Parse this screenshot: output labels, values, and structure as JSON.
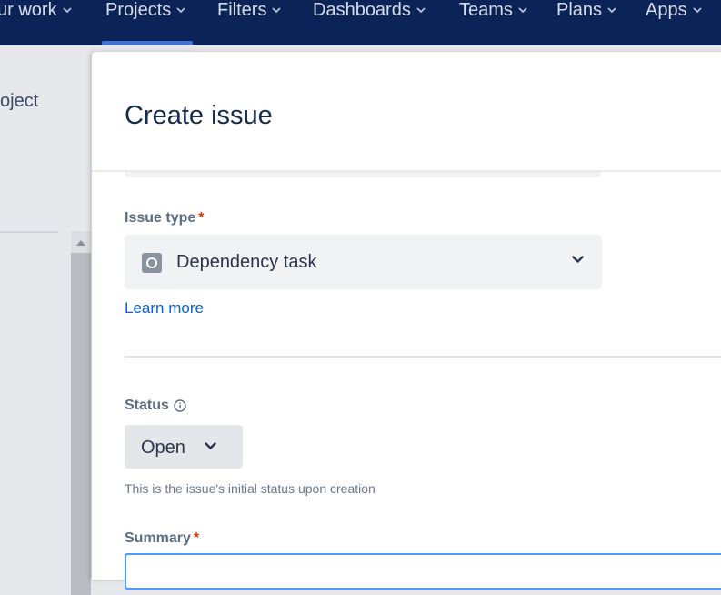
{
  "topnav": {
    "items": [
      {
        "label": "ur work"
      },
      {
        "label": "Projects"
      },
      {
        "label": "Filters"
      },
      {
        "label": "Dashboards"
      },
      {
        "label": "Teams"
      },
      {
        "label": "Plans"
      },
      {
        "label": "Apps"
      }
    ],
    "active_item": "Projects"
  },
  "background": {
    "title_fragment": "oject"
  },
  "modal": {
    "title": "Create issue",
    "issue_type": {
      "label": "Issue type",
      "required_mark": "*",
      "value": "Dependency task",
      "icon": "dependency-task-icon"
    },
    "learn_more": "Learn more",
    "status": {
      "label": "Status",
      "info_icon": "info-icon",
      "value": "Open",
      "helper": "This is the issue's initial status upon creation"
    },
    "summary": {
      "label": "Summary",
      "required_mark": "*",
      "value": ""
    }
  },
  "colors": {
    "nav_bg": "#0b2356",
    "accent": "#3d72d6",
    "link": "#0c5fd0",
    "required": "#de350b",
    "focus": "#4c9aff"
  }
}
